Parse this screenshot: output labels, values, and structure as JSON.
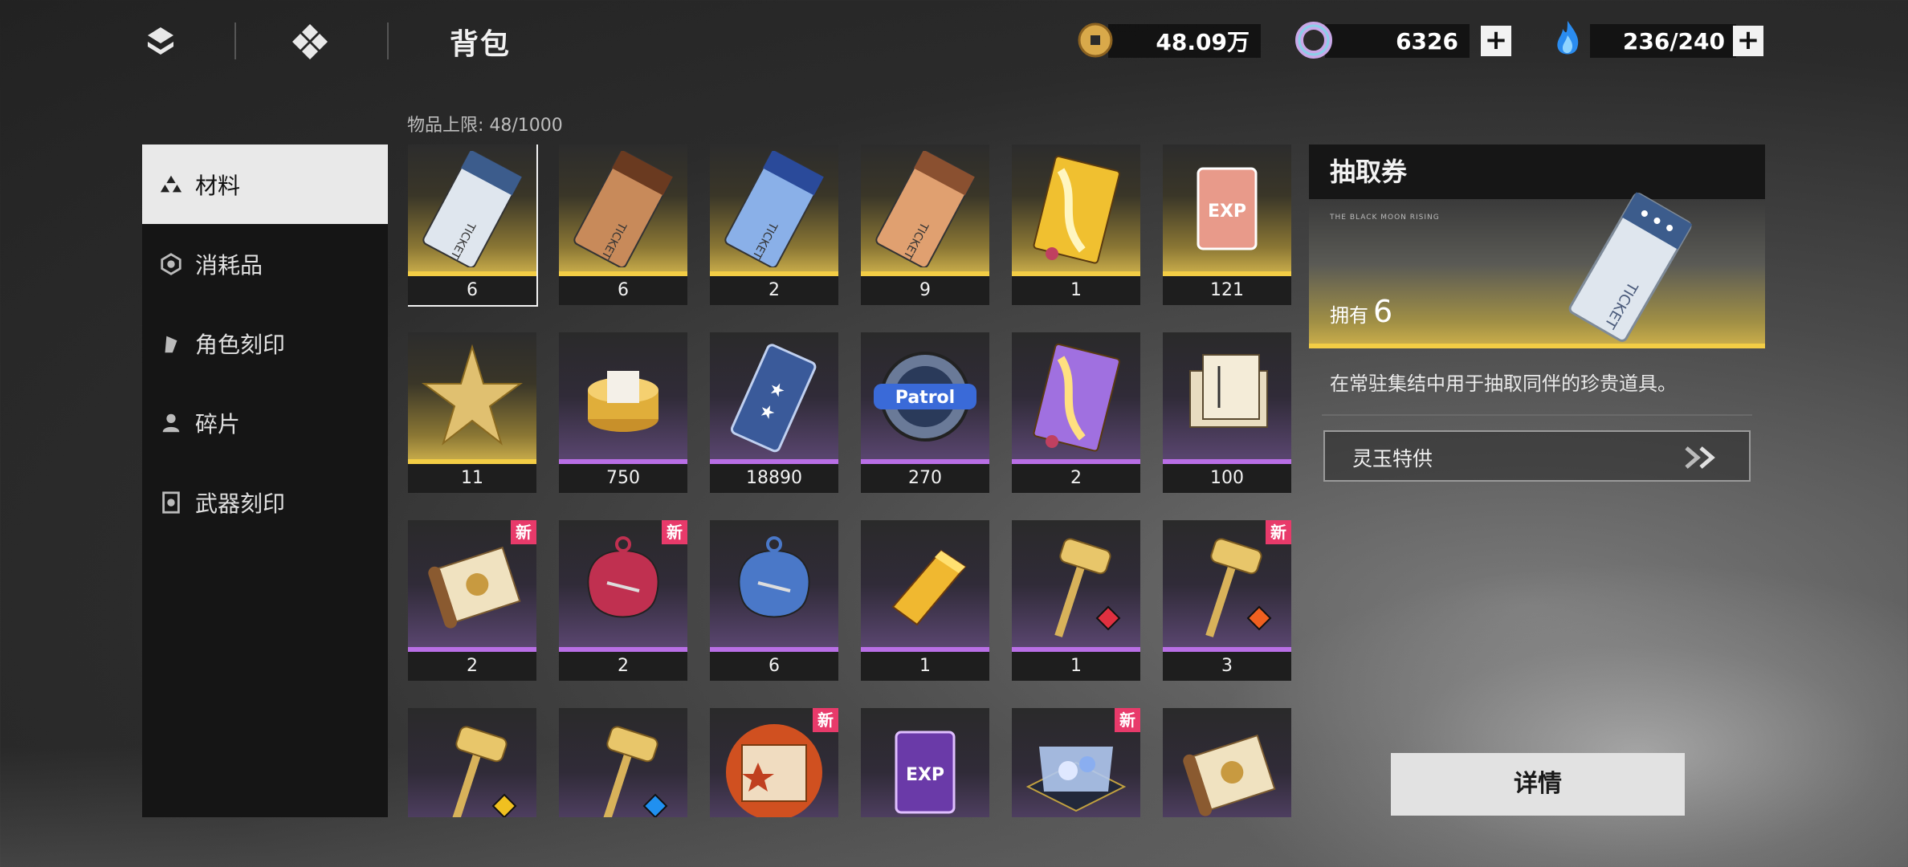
{
  "header": {
    "title": "背包",
    "currencies": [
      {
        "icon": "gold-coin-icon",
        "value": "48.09万"
      },
      {
        "icon": "jade-ring-icon",
        "value": "6326"
      },
      {
        "icon": "blue-flame-icon",
        "value": "236/240"
      }
    ],
    "plus": "+"
  },
  "inventory": {
    "capacity_label": "物品上限: 48/1000"
  },
  "sidebar": {
    "items": [
      {
        "label": "材料",
        "icon": "materials-icon",
        "active": true
      },
      {
        "label": "消耗品",
        "icon": "consumables-icon"
      },
      {
        "label": "角色刻印",
        "icon": "character-imprint-icon"
      },
      {
        "label": "碎片",
        "icon": "fragments-icon"
      },
      {
        "label": "武器刻印",
        "icon": "weapon-imprint-icon"
      }
    ]
  },
  "items": [
    {
      "name": "silver-ticket",
      "qty": "6",
      "rarity": "gold"
    },
    {
      "name": "bronze-ticket",
      "qty": "6",
      "rarity": "gold"
    },
    {
      "name": "blue-ticket",
      "qty": "2",
      "rarity": "gold"
    },
    {
      "name": "copper-ticket",
      "qty": "9",
      "rarity": "gold"
    },
    {
      "name": "gold-book",
      "qty": "1",
      "rarity": "gold"
    },
    {
      "name": "exp-card-gold",
      "qty": "121",
      "rarity": "gold"
    },
    {
      "name": "gold-star",
      "qty": "11",
      "rarity": "gold"
    },
    {
      "name": "coin-stack",
      "qty": "750",
      "rarity": "purple"
    },
    {
      "name": "star-ticket",
      "qty": "18890",
      "rarity": "purple"
    },
    {
      "name": "patrol-badge",
      "qty": "270",
      "rarity": "purple"
    },
    {
      "name": "purple-book",
      "qty": "2",
      "rarity": "purple"
    },
    {
      "name": "scroll-bundle",
      "qty": "100",
      "rarity": "purple"
    },
    {
      "name": "scroll",
      "qty": "2",
      "rarity": "purple",
      "new": true
    },
    {
      "name": "red-charm",
      "qty": "2",
      "rarity": "purple",
      "new": true
    },
    {
      "name": "blue-charm",
      "qty": "6",
      "rarity": "purple"
    },
    {
      "name": "gold-bar",
      "qty": "1",
      "rarity": "purple"
    },
    {
      "name": "hammer-red",
      "qty": "1",
      "rarity": "purple"
    },
    {
      "name": "hammer-orange",
      "qty": "3",
      "rarity": "purple",
      "new": true
    },
    {
      "name": "hammer-yellow",
      "qty": "",
      "rarity": "purple"
    },
    {
      "name": "hammer-blue",
      "qty": "",
      "rarity": "purple"
    },
    {
      "name": "fire-book",
      "qty": "",
      "rarity": "purple",
      "new": true
    },
    {
      "name": "exp-card-purple",
      "qty": "",
      "rarity": "purple"
    },
    {
      "name": "crystal-box",
      "qty": "",
      "rarity": "purple",
      "new": true
    },
    {
      "name": "scroll-2",
      "qty": "",
      "rarity": "purple"
    }
  ],
  "new_badge": "新",
  "item_art": {
    "ticket_text": "TICKET",
    "exp_text": "EXP",
    "patrol_text": "Patrol"
  },
  "detail": {
    "title": "抽取券",
    "tagline": "THE BLACK MOON RISING",
    "owned_label": "拥有",
    "owned_count": "6",
    "description": "在常驻集结中用于抽取同伴的珍贵道具。",
    "link_label": "灵玉特供",
    "details_button": "详情"
  },
  "colors": {
    "gold_bar": "#f3cd45",
    "purple_bar": "#b96fe6",
    "new_badge": "#e83a6a"
  }
}
